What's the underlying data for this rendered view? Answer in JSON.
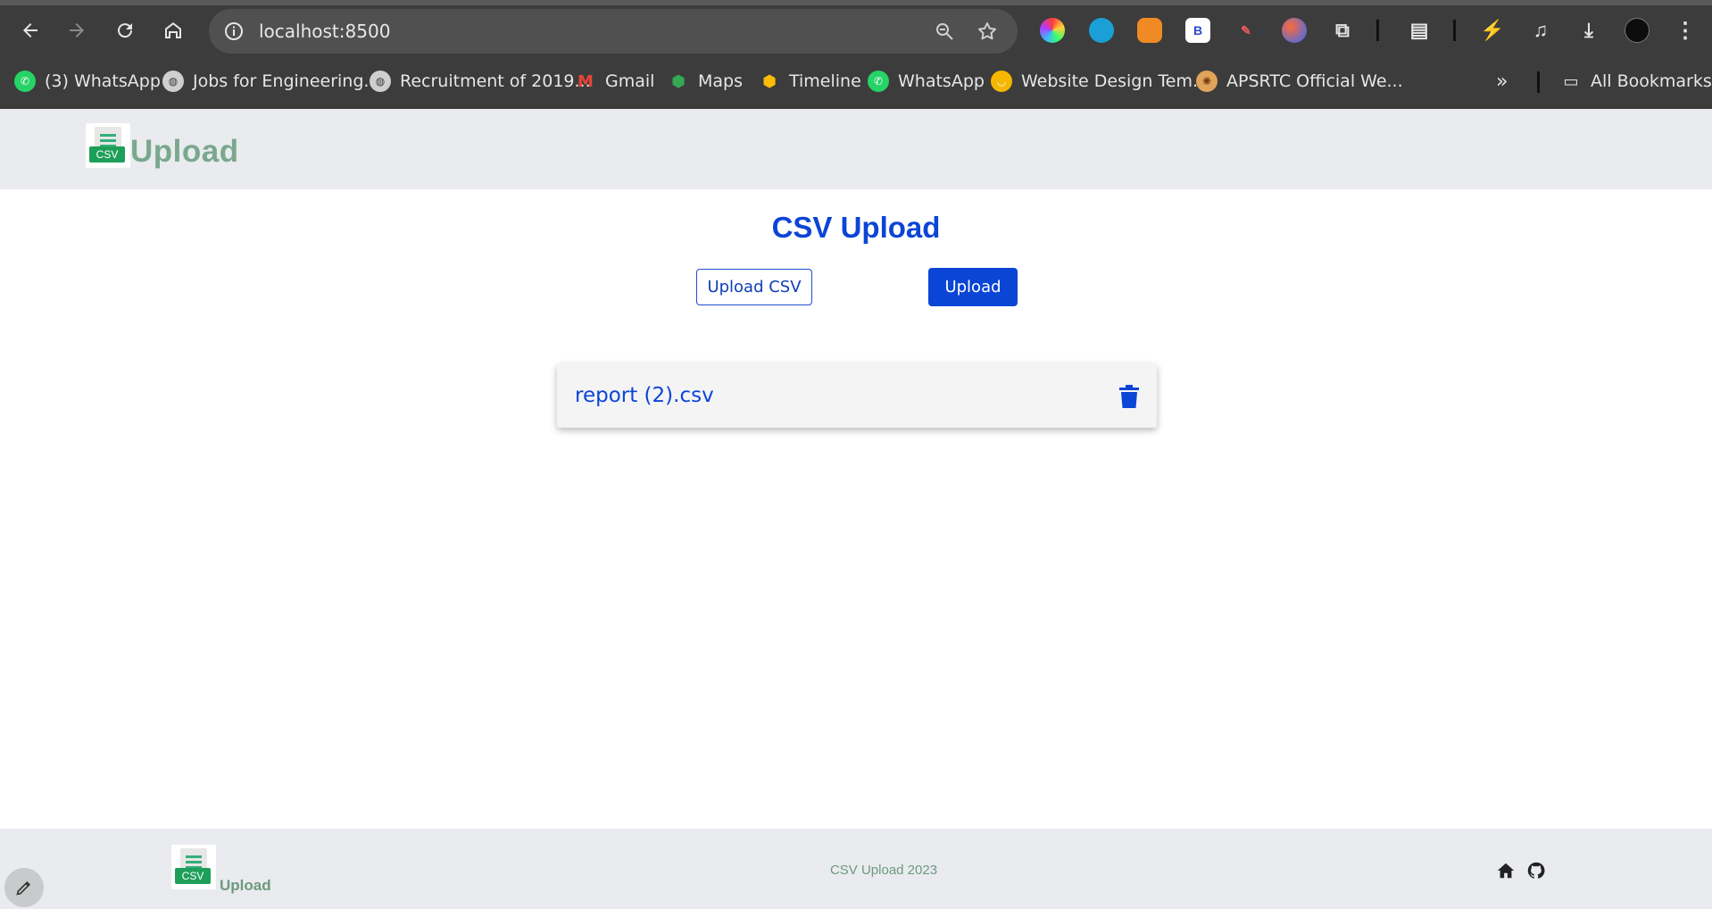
{
  "browser": {
    "url": "localhost:8500",
    "bookmarks": [
      {
        "label": "(3) WhatsApp",
        "icon": "whatsapp-icon"
      },
      {
        "label": "Jobs for Engineering...",
        "icon": "globe-icon"
      },
      {
        "label": "Recruitment of 2019...",
        "icon": "globe-icon"
      },
      {
        "label": "Gmail",
        "icon": "gmail-icon"
      },
      {
        "label": "Maps",
        "icon": "maps-icon"
      },
      {
        "label": "Timeline",
        "icon": "maps-icon"
      },
      {
        "label": "WhatsApp",
        "icon": "whatsapp-icon"
      },
      {
        "label": "Website Design Tem...",
        "icon": "uiverse-icon"
      },
      {
        "label": "APSRTC Official We...",
        "icon": "apsrtc-icon"
      }
    ],
    "all_bookmarks": "All Bookmarks",
    "ext_b_label": "B"
  },
  "header": {
    "logo_tag": "CSV",
    "title": "Upload"
  },
  "main": {
    "title": "CSV Upload",
    "upload_csv_label": "Upload CSV",
    "upload_label": "Upload",
    "files": [
      {
        "name": "report (2).csv"
      }
    ]
  },
  "footer": {
    "logo_tag": "CSV",
    "title": "Upload",
    "copyright": "CSV Upload 2023"
  },
  "colors": {
    "primary": "#0b45d6",
    "header_bg": "#e9ebef",
    "logo_green": "#7aa88e"
  }
}
